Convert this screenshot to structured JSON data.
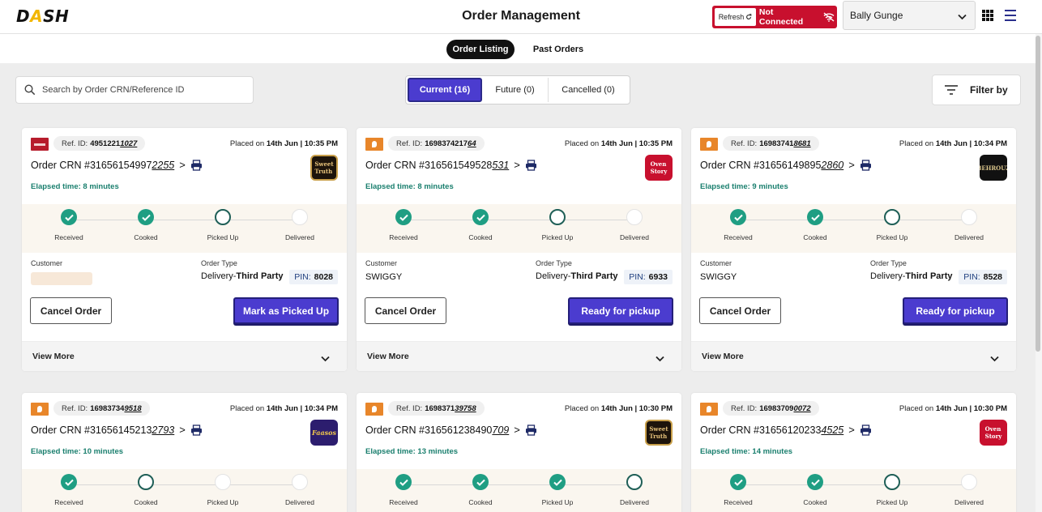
{
  "app": {
    "logo": "DASH",
    "title": "Order Management"
  },
  "connection": {
    "refresh_label": "Refresh",
    "status": "Not Connected"
  },
  "outlet": {
    "selected": "Bally Gunge"
  },
  "subnav": {
    "active": "Order Listing",
    "inactive": "Past Orders"
  },
  "search": {
    "placeholder": "Search by Order CRN/Reference ID"
  },
  "status_tabs": [
    "Current (16)",
    "Future (0)",
    "Cancelled (0)"
  ],
  "filter": {
    "label": "Filter by"
  },
  "card_labels": {
    "ref_prefix": "Ref. ID:",
    "placed_prefix": "Placed on",
    "crn_prefix": "Order CRN #",
    "customer": "Customer",
    "order_type": "Order Type",
    "type_prefix": "Delivery-",
    "type_bold": "Third Party",
    "pin_prefix": "PIN:",
    "cancel": "Cancel Order",
    "view_more": "View More",
    "steps": [
      "Received",
      "Cooked",
      "Picked Up",
      "Delivered"
    ]
  },
  "orders": [
    {
      "source": "zomato",
      "ref_main": "4951221",
      "ref_tail": "1027",
      "placed": "14th Jun | 10:35 PM",
      "crn_main": "31656154997",
      "crn_tail": "2255",
      "elapsed": "Elapsed time: 8 minutes",
      "restaurant_logo": "Sweet Truth",
      "customer": "",
      "pin": "8028",
      "action": "Mark as Picked Up",
      "step_status": [
        "done",
        "done",
        "open",
        "todo"
      ]
    },
    {
      "source": "swiggy",
      "ref_main": "1698374217",
      "ref_tail": "64",
      "placed": "14th Jun | 10:35 PM",
      "crn_main": "316561549528",
      "crn_tail": "531",
      "elapsed": "Elapsed time: 8 minutes",
      "restaurant_logo": "Oven Story",
      "customer": "SWIGGY",
      "pin": "6933",
      "action": "Ready for pickup",
      "step_status": [
        "done",
        "done",
        "open",
        "todo"
      ]
    },
    {
      "source": "swiggy",
      "ref_main": "16983741",
      "ref_tail": "8681",
      "placed": "14th Jun | 10:34 PM",
      "crn_main": "31656149895",
      "crn_tail": "2860",
      "elapsed": "Elapsed time: 9 minutes",
      "restaurant_logo": "Behrouz",
      "customer": "SWIGGY",
      "pin": "8528",
      "action": "Ready for pickup",
      "step_status": [
        "done",
        "done",
        "open",
        "todo"
      ]
    },
    {
      "source": "swiggy",
      "ref_main": "16983734",
      "ref_tail": "9518",
      "placed": "14th Jun | 10:34 PM",
      "crn_main": "31656145213",
      "crn_tail": "2793",
      "elapsed": "Elapsed time: 10 minutes",
      "restaurant_logo": "Faasos",
      "step_status": [
        "done",
        "open",
        "todo",
        "todo"
      ]
    },
    {
      "source": "swiggy",
      "ref_main": "1698371",
      "ref_tail": "39758",
      "placed": "14th Jun | 10:30 PM",
      "crn_main": "316561238490",
      "crn_tail": "709",
      "elapsed": "Elapsed time: 13 minutes",
      "restaurant_logo": "Sweet Truth",
      "step_status": [
        "done",
        "done",
        "done",
        "open"
      ]
    },
    {
      "source": "swiggy",
      "ref_main": "16983709",
      "ref_tail": "0072",
      "placed": "14th Jun | 10:30 PM",
      "crn_main": "31656120233",
      "crn_tail": "4525",
      "elapsed": "Elapsed time: 14 minutes",
      "restaurant_logo": "Oven Story",
      "step_status": [
        "done",
        "done",
        "open",
        "todo"
      ]
    }
  ]
}
